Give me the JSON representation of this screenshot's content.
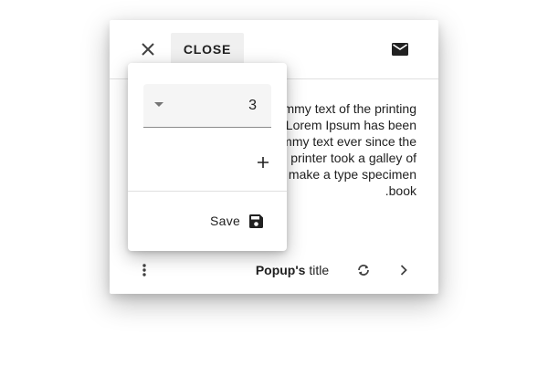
{
  "header": {
    "close_button_label": "CLOSE",
    "icons": [
      "close-icon",
      "mail-icon"
    ]
  },
  "body": {
    "text": "Lorem Ipsum is simply dummy text of the printing and typesetting industry. Lorem Ipsum has been the industry's standard dummy text ever since the 1500s, when an unknown printer took a galley of type and scrambled it to make a type specimen book."
  },
  "footer": {
    "title_bold": "Popup's",
    "title_rest": " title",
    "icons": [
      "more-vert-icon",
      "refresh-icon",
      "chevron-right-icon"
    ]
  },
  "panel": {
    "select_value": "3",
    "save_label": "Save",
    "icons": [
      "dropdown-arrow-icon",
      "add-icon",
      "save-icon"
    ]
  },
  "colors": {
    "text": "#212121",
    "icon": "#424242",
    "button_bg": "#f0f0f0",
    "divider": "#e0e0e0",
    "field_bg": "#f5f5f5"
  }
}
